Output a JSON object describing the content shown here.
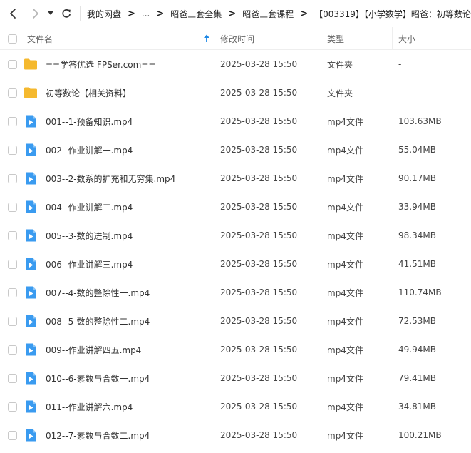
{
  "toolbar": {
    "back_icon": "chevron-left-icon",
    "forward_icon": "chevron-right-icon",
    "history_icon": "caret-down-icon",
    "refresh_icon": "refresh-icon"
  },
  "breadcrumb": {
    "items": [
      "我的网盘",
      "...",
      "昭爸三套全集",
      "昭爸三套课程",
      "【003319】【小学数学】昭爸：初等数论"
    ],
    "separator": ">"
  },
  "header": {
    "name": "文件名",
    "modified": "修改时间",
    "type": "类型",
    "size": "大小"
  },
  "colors": {
    "folder": "#f5b82e",
    "video": "#3a9bf0",
    "sort_arrow": "#1e88e5"
  },
  "files": [
    {
      "icon": "folder-icon",
      "name": "==学答优选 FPSer.com==",
      "modified": "2025-03-28 15:50",
      "type": "文件夹",
      "size": "-"
    },
    {
      "icon": "folder-icon",
      "name": "初等数论【相关资料】",
      "modified": "2025-03-28 15:50",
      "type": "文件夹",
      "size": "-"
    },
    {
      "icon": "video-file-icon",
      "name": "001--1-预备知识.mp4",
      "modified": "2025-03-28 15:50",
      "type": "mp4文件",
      "size": "103.63MB"
    },
    {
      "icon": "video-file-icon",
      "name": "002--作业讲解一.mp4",
      "modified": "2025-03-28 15:50",
      "type": "mp4文件",
      "size": "55.04MB"
    },
    {
      "icon": "video-file-icon",
      "name": "003--2-数系的扩充和无穷集.mp4",
      "modified": "2025-03-28 15:50",
      "type": "mp4文件",
      "size": "90.17MB"
    },
    {
      "icon": "video-file-icon",
      "name": "004--作业讲解二.mp4",
      "modified": "2025-03-28 15:50",
      "type": "mp4文件",
      "size": "33.94MB"
    },
    {
      "icon": "video-file-icon",
      "name": "005--3-数的进制.mp4",
      "modified": "2025-03-28 15:50",
      "type": "mp4文件",
      "size": "98.34MB"
    },
    {
      "icon": "video-file-icon",
      "name": "006--作业讲解三.mp4",
      "modified": "2025-03-28 15:50",
      "type": "mp4文件",
      "size": "41.51MB"
    },
    {
      "icon": "video-file-icon",
      "name": "007--4-数的整除性一.mp4",
      "modified": "2025-03-28 15:50",
      "type": "mp4文件",
      "size": "110.74MB"
    },
    {
      "icon": "video-file-icon",
      "name": "008--5-数的整除性二.mp4",
      "modified": "2025-03-28 15:50",
      "type": "mp4文件",
      "size": "72.53MB"
    },
    {
      "icon": "video-file-icon",
      "name": "009--作业讲解四五.mp4",
      "modified": "2025-03-28 15:50",
      "type": "mp4文件",
      "size": "49.94MB"
    },
    {
      "icon": "video-file-icon",
      "name": "010--6-素数与合数一.mp4",
      "modified": "2025-03-28 15:50",
      "type": "mp4文件",
      "size": "79.41MB"
    },
    {
      "icon": "video-file-icon",
      "name": "011--作业讲解六.mp4",
      "modified": "2025-03-28 15:50",
      "type": "mp4文件",
      "size": "34.81MB"
    },
    {
      "icon": "video-file-icon",
      "name": "012--7-素数与合数二.mp4",
      "modified": "2025-03-28 15:50",
      "type": "mp4文件",
      "size": "100.21MB"
    }
  ]
}
